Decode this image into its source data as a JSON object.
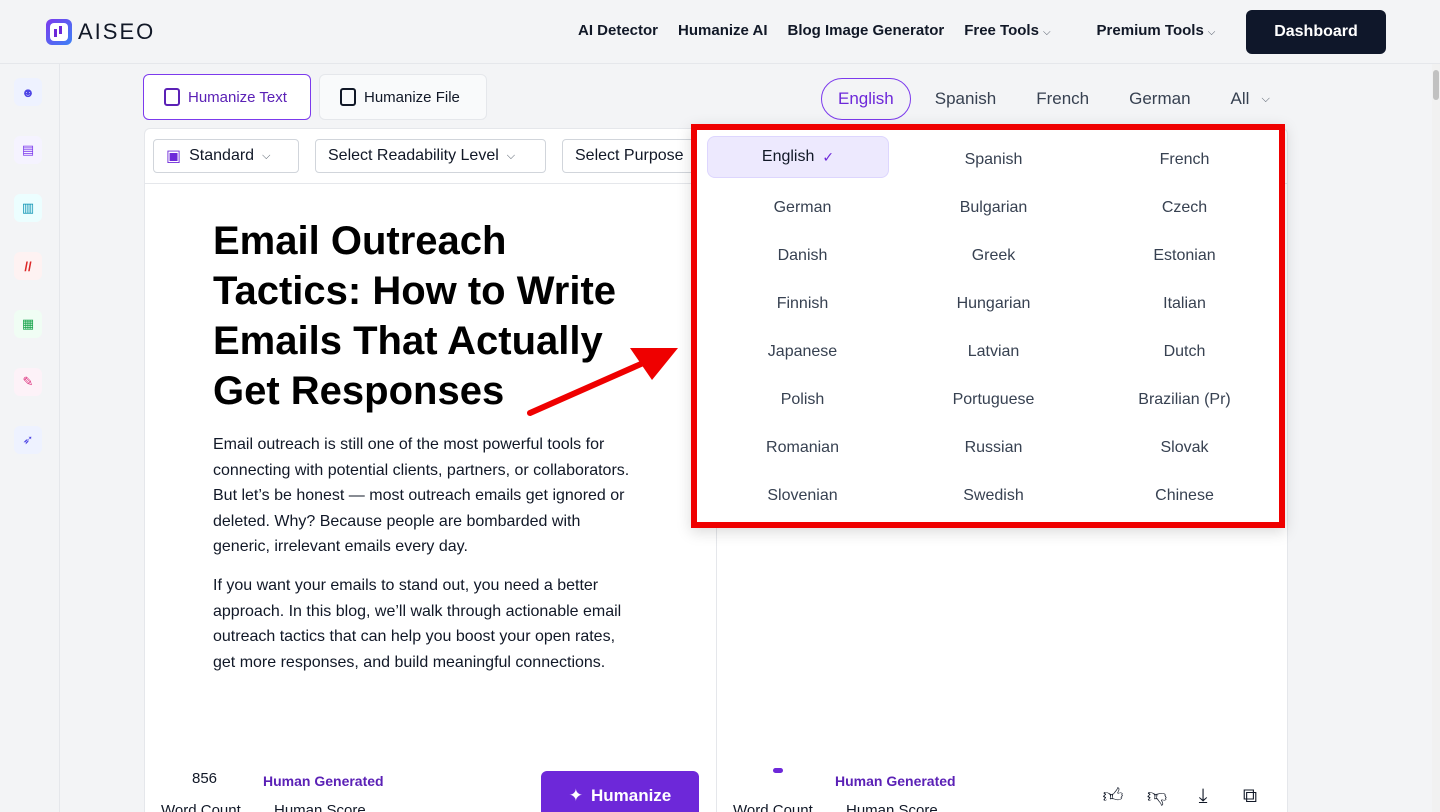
{
  "brand": {
    "name": "AISEO"
  },
  "nav": {
    "links": [
      "AI Detector",
      "Humanize AI",
      "Blog Image Generator"
    ],
    "free_tools": "Free Tools",
    "premium_tools": "Premium Tools",
    "dashboard": "Dashboard"
  },
  "modes": {
    "humanize_text": "Humanize Text",
    "humanize_file": "Humanize File"
  },
  "lang_tabs": {
    "english": "English",
    "spanish": "Spanish",
    "french": "French",
    "german": "German",
    "all": "All"
  },
  "toolbar": {
    "standard": "Standard",
    "readability": "Select Readability Level",
    "purpose": "Select Purpose"
  },
  "article": {
    "title": "Email Outreach Tactics: How to Write Emails That Actually Get Responses",
    "p1": "Email outreach is still one of the most powerful tools for connecting with potential clients, partners, or collaborators. But let’s be honest — most outreach emails get ignored or deleted. Why? Because people are bombarded with generic, irrelevant emails every day.",
    "p2": "If you want your emails to stand out, you need a better approach. In this blog, we’ll walk through actionable email outreach tactics that can help you boost your open rates, get more responses, and build meaningful connections."
  },
  "footer": {
    "word_count_value": "856",
    "human_generated": "Human Generated",
    "word_count_label": "Word Count",
    "human_score_label": "Human Score",
    "humanize_button": "Humanize",
    "right_human_generated": "Human Generated",
    "right_word_count_label": "Word Count",
    "right_human_score_label": "Human Score"
  },
  "language_dropdown": {
    "selected": "English",
    "items": [
      "English",
      "Spanish",
      "French",
      "German",
      "Bulgarian",
      "Czech",
      "Danish",
      "Greek",
      "Estonian",
      "Finnish",
      "Hungarian",
      "Italian",
      "Japanese",
      "Latvian",
      "Dutch",
      "Polish",
      "Portuguese",
      "Brazilian (Pr)",
      "Romanian",
      "Russian",
      "Slovak",
      "Slovenian",
      "Swedish",
      "Chinese"
    ]
  },
  "colors": {
    "accent": "#6d28d9",
    "highlight_border": "#ef0000",
    "dashboard_bg": "#0f172a"
  }
}
